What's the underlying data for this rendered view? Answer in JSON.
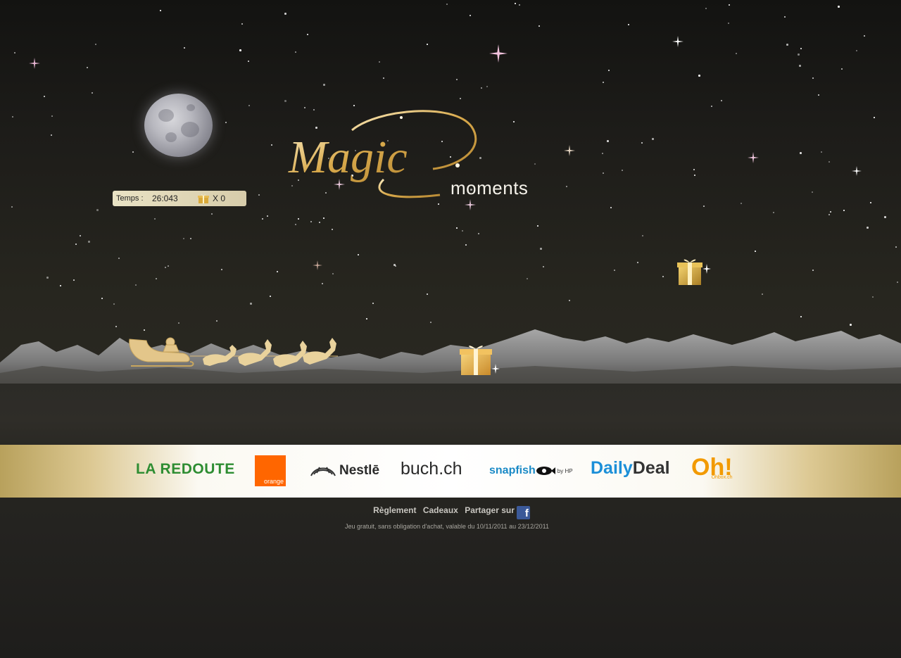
{
  "logo": {
    "title": "Magic",
    "subtitle": "moments"
  },
  "hud": {
    "time_label": "Temps :",
    "time_value": "26:043",
    "gift_count": "X 0"
  },
  "sponsors": {
    "redoute": "LA REDOUTE",
    "orange": "orange",
    "nestle": "Nestlē",
    "buch": "buch.ch",
    "snapfish": "snapfish",
    "snapfish_by": "by HP",
    "daily_deal_1": "Daily",
    "daily_deal_2": "Deal",
    "oh": "Oh!",
    "oh_sub": "Ohbox.ch"
  },
  "footer": {
    "reglement": "Règlement",
    "cadeaux": "Cadeaux",
    "partager": "Partager sur",
    "facebook_glyph": "f",
    "note": "Jeu gratuit, sans obligation d'achat, valable du 10/11/2011 au 23/12/2011"
  },
  "colors": {
    "gold": "#d9b877",
    "sky_top": "#131311",
    "sky_bottom": "#2a2822",
    "hud_bg": "#e9e2c4",
    "facebook": "#3b5998"
  }
}
